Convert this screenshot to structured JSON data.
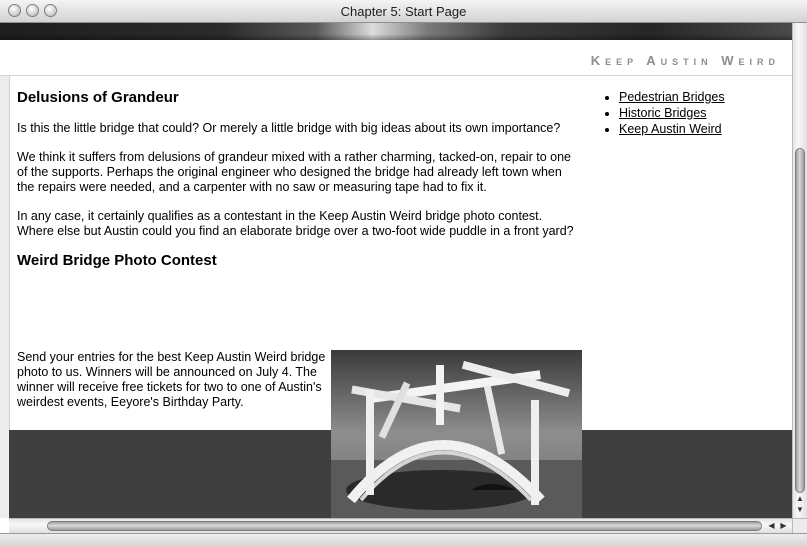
{
  "window": {
    "title": "Chapter 5: Start Page"
  },
  "header": {
    "brand": "Keep Austin Weird"
  },
  "main": {
    "heading1": "Delusions of Grandeur",
    "para1": "Is this the little bridge that could? Or merely a little bridge with big ideas about its own importance?",
    "para2": "We think it suffers from delusions of grandeur mixed with a rather charming, tacked-on, repair to one of the supports. Perhaps the original engineer who designed the bridge had already left town when the repairs were needed, and a carpenter with no saw or measuring tape had to fix it.",
    "para3": "In any case, it certainly qualifies as a contestant in the Keep Austin Weird bridge photo contest. Where else but Austin could you find an elaborate bridge over a two-foot wide puddle in a front yard?",
    "heading2": "Weird Bridge Photo Contest",
    "para4": "Send your entries for the best Keep Austin Weird bridge photo to us. Winners will be announced on July 4. The winner will receive free tickets for two to one of Austin's weirdest events, Eeyore's Birthday Party."
  },
  "sidebar": {
    "links": [
      "Pedestrian Bridges",
      "Historic Bridges",
      "Keep Austin Weird"
    ]
  },
  "icons": {
    "close": "traffic-light-close",
    "minimize": "traffic-light-minimize",
    "zoom": "traffic-light-zoom",
    "up": "▲",
    "down": "▼",
    "left": "◀",
    "right": "▶"
  },
  "colors": {
    "dark_band": "#3f3f3f",
    "brand_text": "#8e8e8e"
  }
}
